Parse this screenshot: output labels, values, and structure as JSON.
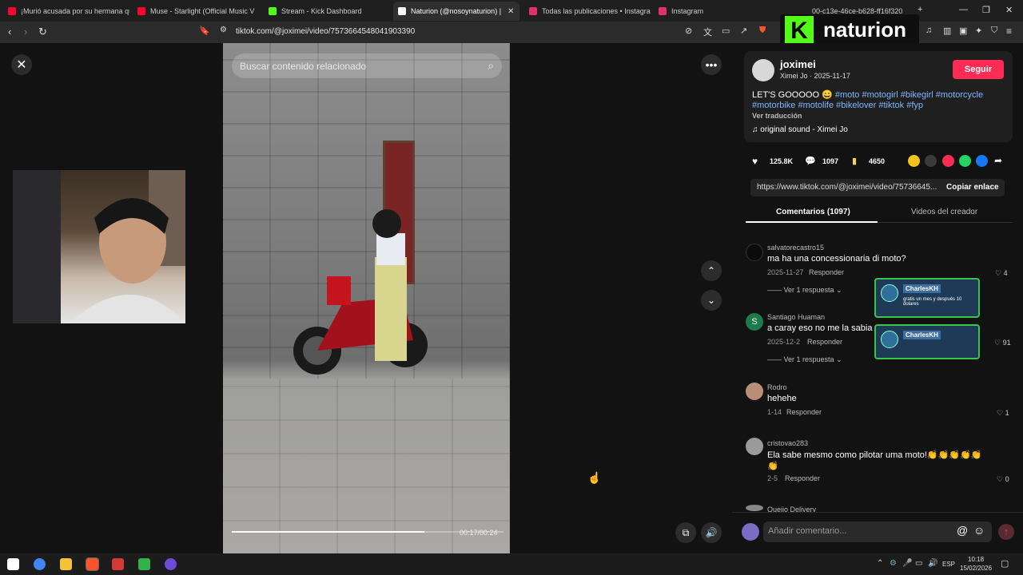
{
  "browser": {
    "tabs": [
      {
        "label": "¡Murió acusada por su hermana que",
        "icon": "youtube-icon",
        "color": "#ff0033"
      },
      {
        "label": "Muse - Starlight (Official Music V",
        "icon": "youtube-icon",
        "color": "#ff0033"
      },
      {
        "label": "Stream - Kick Dashboard",
        "icon": "kick-icon",
        "color": "#53fc18"
      },
      {
        "label": "Naturion (@nosoynaturion) |",
        "icon": "tiktok-icon",
        "color": "#ffffff"
      },
      {
        "label": "Todas las publicaciones • Instagram",
        "icon": "instagram-icon",
        "color": "#e1306c"
      },
      {
        "label": "Instagram",
        "icon": "instagram-icon",
        "color": "#e1306c"
      },
      {
        "label": "00-c13e-46ce-b628-ff16f320",
        "icon": "tab-icon",
        "color": "#888888"
      }
    ],
    "url": "tiktok.com/@joximei/video/7573664548041903390"
  },
  "brand_overlay": {
    "letter": "K",
    "name": "naturion"
  },
  "video": {
    "search_placeholder": "Buscar contenido relacionado",
    "time": "00:17/00:24",
    "progress": 0.71
  },
  "post": {
    "username": "joximei",
    "subtitle": "Ximei Jo · 2025-11-17",
    "follow_label": "Seguir",
    "caption_text": "LET'S GOOOOO 😄",
    "hashtags_line1": "#moto #motogirl #bikegirl #motorcycle",
    "hashtags_line2": "#motorbike #motolife #bikelover #tiktok #fyp",
    "translate": "Ver traducción",
    "sound": "original sound - Ximei Jo",
    "likes": "125.8K",
    "comments": "1097",
    "saves": "4650",
    "link": "https://www.tiktok.com/@joximei/video/75736645...",
    "copy_label": "Copiar enlace"
  },
  "tabs_panel": {
    "comments_tab": "Comentarios (1097)",
    "creator_tab": "Videos del creador"
  },
  "comments": [
    {
      "user": "salvatorecastro15",
      "text": "ma ha una concessionaria di moto?",
      "date": "2025-11-27",
      "reply": "Responder",
      "likes": "4",
      "replies": "Ver 1 respuesta"
    },
    {
      "user": "Santiago Huaman",
      "text": "a caray eso no me la sabia",
      "date": "2025-12-2",
      "reply": "Responder",
      "likes": "91",
      "replies": "Ver 1 respuesta",
      "initial": "S"
    },
    {
      "user": "Rodro",
      "text": "hehehe",
      "date": "1-14",
      "reply": "Responder",
      "likes": "1"
    },
    {
      "user": "cristovao283",
      "text": "Ela sabe mesmo como pilotar uma moto!👏👏👏👏👏",
      "text2": "👏",
      "date": "2-5",
      "reply": "Responder",
      "likes": "0"
    },
    {
      "user": "Queijo Delivery"
    }
  ],
  "chat_overlays": [
    {
      "name": "CharlesKH",
      "message": "gratis un mes y después 10 dolares"
    },
    {
      "name": "CharlesKH",
      "message": ""
    }
  ],
  "comment_box": {
    "placeholder": "Añadir comentario..."
  },
  "taskbar": {
    "lang": "ESP",
    "time": "10:18",
    "date": "15/02/2026"
  }
}
